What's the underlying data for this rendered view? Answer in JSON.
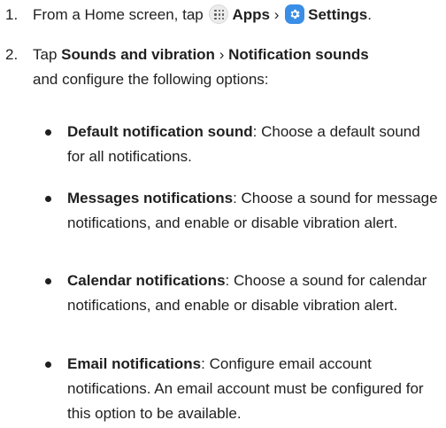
{
  "steps": [
    {
      "number": "1.",
      "parts": {
        "t1": "From a Home screen, tap",
        "apps": "Apps",
        "sep": "›",
        "settings": "Settings",
        "end": "."
      }
    },
    {
      "number": "2.",
      "parts": {
        "t1": "Tap",
        "a": "Sounds and vibration",
        "sep": "›",
        "b": "Notification sounds",
        "t2": "and configure the following options:"
      }
    }
  ],
  "bullets": [
    {
      "term": "Default notification sound",
      "desc": ": Choose a default sound for all notifications."
    },
    {
      "term": "Messages notifications",
      "desc": ": Choose a sound for message notifications, and enable or disable vibration alert."
    },
    {
      "term": "Calendar notifications",
      "desc": ": Choose a sound for calendar notifications, and enable or disable vibration alert."
    },
    {
      "term": "Email notifications",
      "desc": ": Configure email account notifications. An email account must be configured for this option to be available."
    }
  ],
  "icons": {
    "apps": "apps-icon",
    "settings": "settings-icon"
  },
  "colors": {
    "text": "#1f1f1f",
    "settings_icon": "#3a8ee6",
    "apps_icon": "#ececec"
  }
}
